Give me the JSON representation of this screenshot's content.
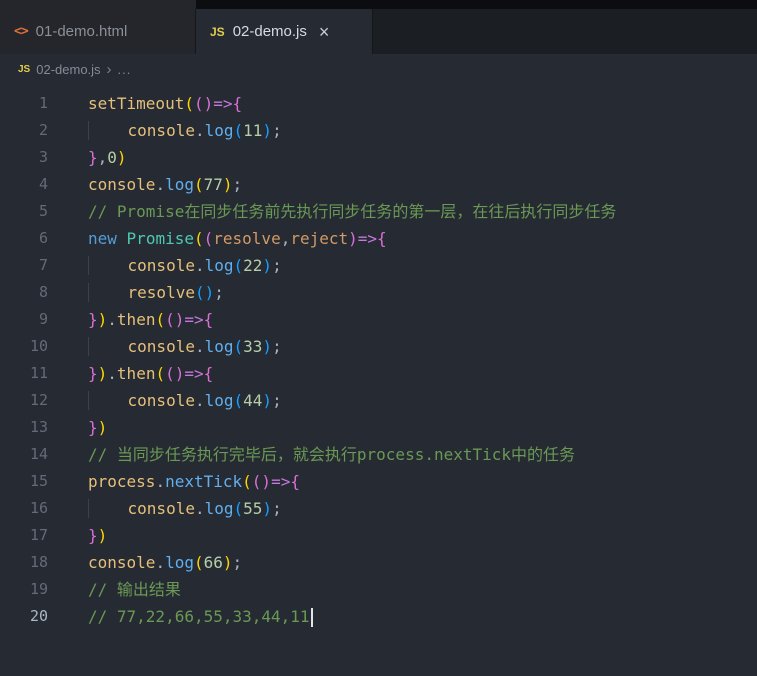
{
  "colors": {
    "fn": "#e5c07b",
    "blue": "#61afef",
    "kw": "#569cd6",
    "cls": "#4ec9b0",
    "param": "#d19a66",
    "num": "#b5cea8",
    "cmt": "#6a9955",
    "pun": "#abb2bf",
    "b1": "#ffd700",
    "b2": "#da70d6",
    "b3": "#179fff",
    "arr": "#c678dd",
    "ind": "#abb2bf",
    "html_icon": "#e0703a",
    "js_icon": "#e2ce4b"
  },
  "tabs": [
    {
      "label": "01-demo.html",
      "icon_glyph": "<>",
      "active": false
    },
    {
      "label": "02-demo.js",
      "icon_glyph": "JS",
      "active": true,
      "close_glyph": "×"
    }
  ],
  "breadcrumb": {
    "icon_glyph": "JS",
    "file": "02-demo.js",
    "separator": "›",
    "symbol": "..."
  },
  "editor": {
    "lines": [
      {
        "n": 1,
        "tokens": [
          [
            "setTimeout",
            "fn"
          ],
          [
            "(",
            "b1"
          ],
          [
            "(",
            "b2"
          ],
          [
            ")",
            "b2"
          ],
          [
            "=>",
            "arr"
          ],
          [
            "{",
            "b2"
          ]
        ]
      },
      {
        "n": 2,
        "tokens": [
          [
            "    ",
            "ind"
          ],
          [
            "console",
            "fn"
          ],
          [
            ".",
            "pun"
          ],
          [
            "log",
            "blue"
          ],
          [
            "(",
            "b3"
          ],
          [
            "11",
            "num"
          ],
          [
            ")",
            "b3"
          ],
          [
            ";",
            "pun"
          ]
        ]
      },
      {
        "n": 3,
        "tokens": [
          [
            "}",
            "b2"
          ],
          [
            ",",
            "pun"
          ],
          [
            "0",
            "num"
          ],
          [
            ")",
            "b1"
          ]
        ]
      },
      {
        "n": 4,
        "tokens": [
          [
            "console",
            "fn"
          ],
          [
            ".",
            "pun"
          ],
          [
            "log",
            "blue"
          ],
          [
            "(",
            "b1"
          ],
          [
            "77",
            "num"
          ],
          [
            ")",
            "b1"
          ],
          [
            ";",
            "pun"
          ]
        ]
      },
      {
        "n": 5,
        "tokens": [
          [
            "// Promise在同步任务前先执行同步任务的第一层，在往后执行同步任务",
            "cmt"
          ]
        ]
      },
      {
        "n": 6,
        "tokens": [
          [
            "new",
            "kw"
          ],
          [
            " ",
            "pun"
          ],
          [
            "Promise",
            "cls"
          ],
          [
            "(",
            "b1"
          ],
          [
            "(",
            "b2"
          ],
          [
            "resolve",
            "param"
          ],
          [
            ",",
            "pun"
          ],
          [
            "reject",
            "param"
          ],
          [
            ")",
            "b2"
          ],
          [
            "=>",
            "arr"
          ],
          [
            "{",
            "b2"
          ]
        ]
      },
      {
        "n": 7,
        "tokens": [
          [
            "    ",
            "ind"
          ],
          [
            "console",
            "fn"
          ],
          [
            ".",
            "pun"
          ],
          [
            "log",
            "blue"
          ],
          [
            "(",
            "b3"
          ],
          [
            "22",
            "num"
          ],
          [
            ")",
            "b3"
          ],
          [
            ";",
            "pun"
          ]
        ]
      },
      {
        "n": 8,
        "tokens": [
          [
            "    ",
            "ind"
          ],
          [
            "resolve",
            "fn"
          ],
          [
            "(",
            "b3"
          ],
          [
            ")",
            "b3"
          ],
          [
            ";",
            "pun"
          ]
        ]
      },
      {
        "n": 9,
        "tokens": [
          [
            "}",
            "b2"
          ],
          [
            ")",
            "b1"
          ],
          [
            ".",
            "pun"
          ],
          [
            "then",
            "fn"
          ],
          [
            "(",
            "b1"
          ],
          [
            "(",
            "b2"
          ],
          [
            ")",
            "b2"
          ],
          [
            "=>",
            "arr"
          ],
          [
            "{",
            "b2"
          ]
        ]
      },
      {
        "n": 10,
        "tokens": [
          [
            "    ",
            "ind"
          ],
          [
            "console",
            "fn"
          ],
          [
            ".",
            "pun"
          ],
          [
            "log",
            "blue"
          ],
          [
            "(",
            "b3"
          ],
          [
            "33",
            "num"
          ],
          [
            ")",
            "b3"
          ],
          [
            ";",
            "pun"
          ]
        ]
      },
      {
        "n": 11,
        "tokens": [
          [
            "}",
            "b2"
          ],
          [
            ")",
            "b1"
          ],
          [
            ".",
            "pun"
          ],
          [
            "then",
            "fn"
          ],
          [
            "(",
            "b1"
          ],
          [
            "(",
            "b2"
          ],
          [
            ")",
            "b2"
          ],
          [
            "=>",
            "arr"
          ],
          [
            "{",
            "b2"
          ]
        ]
      },
      {
        "n": 12,
        "tokens": [
          [
            "    ",
            "ind"
          ],
          [
            "console",
            "fn"
          ],
          [
            ".",
            "pun"
          ],
          [
            "log",
            "blue"
          ],
          [
            "(",
            "b3"
          ],
          [
            "44",
            "num"
          ],
          [
            ")",
            "b3"
          ],
          [
            ";",
            "pun"
          ]
        ]
      },
      {
        "n": 13,
        "tokens": [
          [
            "}",
            "b2"
          ],
          [
            ")",
            "b1"
          ]
        ]
      },
      {
        "n": 14,
        "tokens": [
          [
            "// 当同步任务执行完毕后，就会执行process.nextTick中的任务",
            "cmt"
          ]
        ]
      },
      {
        "n": 15,
        "tokens": [
          [
            "process",
            "fn"
          ],
          [
            ".",
            "pun"
          ],
          [
            "nextTick",
            "blue"
          ],
          [
            "(",
            "b1"
          ],
          [
            "(",
            "b2"
          ],
          [
            ")",
            "b2"
          ],
          [
            "=>",
            "arr"
          ],
          [
            "{",
            "b2"
          ]
        ]
      },
      {
        "n": 16,
        "tokens": [
          [
            "    ",
            "ind"
          ],
          [
            "console",
            "fn"
          ],
          [
            ".",
            "pun"
          ],
          [
            "log",
            "blue"
          ],
          [
            "(",
            "b3"
          ],
          [
            "55",
            "num"
          ],
          [
            ")",
            "b3"
          ],
          [
            ";",
            "pun"
          ]
        ]
      },
      {
        "n": 17,
        "tokens": [
          [
            "}",
            "b2"
          ],
          [
            ")",
            "b1"
          ]
        ]
      },
      {
        "n": 18,
        "tokens": [
          [
            "console",
            "fn"
          ],
          [
            ".",
            "pun"
          ],
          [
            "log",
            "blue"
          ],
          [
            "(",
            "b1"
          ],
          [
            "66",
            "num"
          ],
          [
            ")",
            "b1"
          ],
          [
            ";",
            "pun"
          ]
        ]
      },
      {
        "n": 19,
        "tokens": [
          [
            "// 输出结果",
            "cmt"
          ]
        ]
      },
      {
        "n": 20,
        "tokens": [
          [
            "// 77,22,66,55,33,44,11",
            "cmt"
          ]
        ],
        "cursor": true,
        "current": true
      }
    ]
  }
}
